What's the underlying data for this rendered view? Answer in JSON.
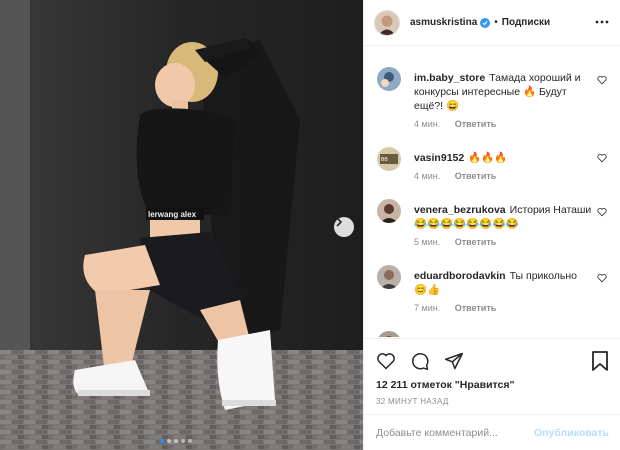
{
  "post": {
    "author": "asmuskristina",
    "follow_label": "Подписки",
    "separator": "•",
    "icons": {
      "verified": "verified-badge-icon",
      "more": "more-options-icon"
    }
  },
  "photo": {
    "wall_color": "#2f2f2f",
    "floor_color": "#6b6b6b",
    "top_text": "lerwang alex",
    "carousel_count": 5,
    "carousel_active": 1
  },
  "comments": [
    {
      "user": "im.baby_store",
      "text": "Тамада хороший и конкурсы интересные 🔥 Будут ещё?! 😄",
      "time": "4 мин.",
      "reply": "Ответить"
    },
    {
      "user": "vasin9152",
      "text": "🔥🔥🔥",
      "time": "4 мин.",
      "reply": "Ответить"
    },
    {
      "user": "venera_bezrukova",
      "text": "История Наташи 😂😂😂😂😂😂😂😂",
      "time": "5 мин.",
      "reply": "Ответить"
    },
    {
      "user": "eduardborodavkin",
      "text": "Ты прикольно 😊👍",
      "time": "7 мин.",
      "reply": "Ответить"
    }
  ],
  "actions": {
    "likes": "12 211 отметок \"Нравится\"",
    "time": "32 МИНУТ НАЗАД",
    "comment_placeholder": "Добавьте комментарий...",
    "publish": "Опубликовать",
    "icons": [
      "heart-icon",
      "comment-icon",
      "share-icon",
      "bookmark-icon"
    ]
  },
  "colors": {
    "accent": "#3897f0",
    "publish_disabled": "#b2dffc",
    "muted": "#8e8e8e"
  }
}
